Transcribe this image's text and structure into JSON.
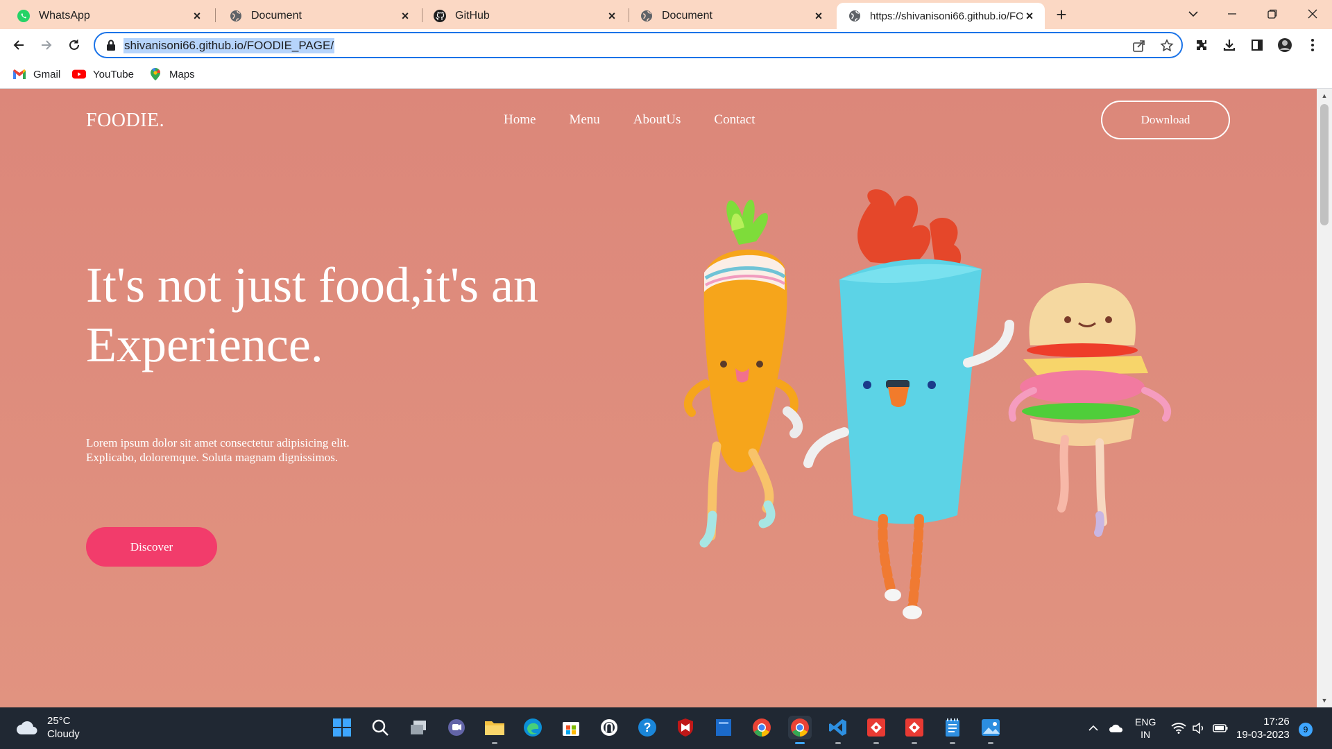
{
  "browser": {
    "tabs": [
      {
        "title": "WhatsApp",
        "icon": "whatsapp-icon",
        "active": false
      },
      {
        "title": "Document",
        "icon": "globe-icon",
        "active": false
      },
      {
        "title": "GitHub",
        "icon": "github-icon",
        "active": false
      },
      {
        "title": "Document",
        "icon": "globe-icon",
        "active": false
      },
      {
        "title": "https://shivanisoni66.github.io/FOODIE_PAGE/",
        "icon": "globe-icon",
        "active": true
      }
    ],
    "url": "shivanisoni66.github.io/FOODIE_PAGE/",
    "bookmarks": [
      {
        "label": "Gmail",
        "icon": "gmail-icon"
      },
      {
        "label": "YouTube",
        "icon": "youtube-icon"
      },
      {
        "label": "Maps",
        "icon": "maps-icon"
      }
    ]
  },
  "site": {
    "logo": "FOODIE.",
    "nav": [
      "Home",
      "Menu",
      "AboutUs",
      "Contact"
    ],
    "download_label": "Download",
    "hero_title": "It's not just food,it's an Experience.",
    "hero_text_line1": "Lorem ipsum dolor sit amet consectetur adipisicing elit.",
    "hero_text_line2": "Explicabo, doloremque. Soluta magnam dignissimos.",
    "discover_label": "Discover",
    "colors": {
      "background": "#dc877a",
      "accent": "#f23c6b"
    }
  },
  "taskbar": {
    "weather_temp": "25°C",
    "weather_desc": "Cloudy",
    "lang_line1": "ENG",
    "lang_line2": "IN",
    "time": "17:26",
    "date": "19-03-2023",
    "notification_count": "9"
  }
}
